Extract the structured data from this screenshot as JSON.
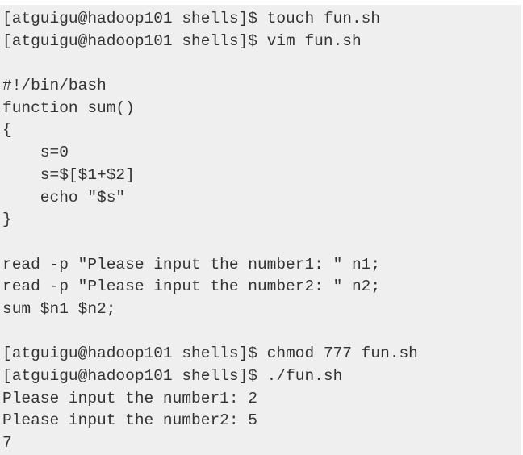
{
  "terminal": {
    "lines": [
      "[atguigu@hadoop101 shells]$ touch fun.sh",
      "[atguigu@hadoop101 shells]$ vim fun.sh",
      "",
      "#!/bin/bash",
      "function sum()",
      "{",
      "    s=0",
      "    s=$[$1+$2]",
      "    echo \"$s\"",
      "}",
      "",
      "read -p \"Please input the number1: \" n1;",
      "read -p \"Please input the number2: \" n2;",
      "sum $n1 $n2;",
      "",
      "[atguigu@hadoop101 shells]$ chmod 777 fun.sh",
      "[atguigu@hadoop101 shells]$ ./fun.sh",
      "Please input the number1: 2",
      "Please input the number2: 5",
      "7"
    ]
  }
}
